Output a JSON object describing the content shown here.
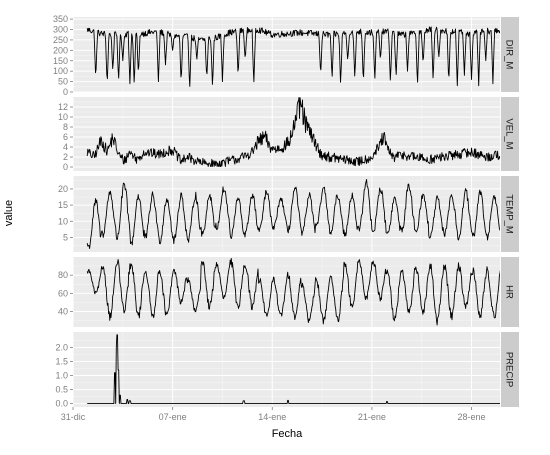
{
  "chart_data": {
    "type": "line",
    "xlabel": "Fecha",
    "ylabel": "value",
    "x_range": [
      "2012-12-31",
      "2013-01-30"
    ],
    "x_ticks": [
      {
        "label": "31-dic",
        "date": "2012-12-31"
      },
      {
        "label": "07-ene",
        "date": "2013-01-07"
      },
      {
        "label": "14-ene",
        "date": "2013-01-14"
      },
      {
        "label": "21-ene",
        "date": "2013-01-21"
      },
      {
        "label": "28-ene",
        "date": "2013-01-28"
      }
    ],
    "data_start": "2013-01-01",
    "data_end": "2013-01-30",
    "colors": {
      "line": "#000000",
      "panel_bg": "#ebebeb",
      "grid_major": "#ffffff",
      "strip_bg": "#cccccc",
      "tick_text": "#7f7f7f"
    },
    "grid": true,
    "panels": [
      {
        "name": "DIR_M",
        "ylim": [
          0,
          360
        ],
        "y_ticks": [
          0,
          50,
          100,
          150,
          200,
          250,
          300,
          350
        ],
        "y_tick_labels": [
          "0",
          "50",
          "100",
          "150",
          "200",
          "250",
          "300",
          "350"
        ],
        "pattern": "direction",
        "anchors": [
          [
            1,
            300
          ],
          [
            2,
            280
          ],
          [
            3,
            275
          ],
          [
            4,
            280
          ],
          [
            5,
            282
          ],
          [
            6,
            290
          ],
          [
            7,
            270
          ],
          [
            8,
            265
          ],
          [
            9,
            250
          ],
          [
            10,
            260
          ],
          [
            11,
            285
          ],
          [
            12,
            295
          ],
          [
            13,
            300
          ],
          [
            14,
            275
          ],
          [
            15,
            280
          ],
          [
            16,
            285
          ],
          [
            17,
            280
          ],
          [
            18,
            275
          ],
          [
            19,
            280
          ],
          [
            20,
            290
          ],
          [
            21,
            285
          ],
          [
            22,
            290
          ],
          [
            23,
            275
          ],
          [
            24,
            280
          ],
          [
            25,
            300
          ],
          [
            26,
            295
          ],
          [
            27,
            290
          ],
          [
            28,
            280
          ],
          [
            29,
            290
          ],
          [
            30,
            300
          ]
        ],
        "events": [
          [
            1.6,
            60
          ],
          [
            2.4,
            30
          ],
          [
            2.8,
            100
          ],
          [
            3.2,
            50
          ],
          [
            3.5,
            150
          ],
          [
            4.0,
            40
          ],
          [
            4.3,
            30
          ],
          [
            4.6,
            80
          ],
          [
            6.0,
            50
          ],
          [
            6.5,
            130
          ],
          [
            7.0,
            200
          ],
          [
            7.6,
            40
          ],
          [
            8.2,
            10
          ],
          [
            8.7,
            150
          ],
          [
            9.4,
            60
          ],
          [
            9.8,
            20
          ],
          [
            10.5,
            50
          ],
          [
            11.6,
            70
          ],
          [
            12.1,
            150
          ],
          [
            12.7,
            30
          ],
          [
            17.4,
            80
          ],
          [
            18.2,
            60
          ],
          [
            18.8,
            30
          ],
          [
            19.3,
            150
          ],
          [
            19.8,
            60
          ],
          [
            20.4,
            40
          ],
          [
            21.2,
            50
          ],
          [
            21.6,
            150
          ],
          [
            22.3,
            40
          ],
          [
            22.7,
            70
          ],
          [
            23.5,
            100
          ],
          [
            24.2,
            30
          ],
          [
            24.6,
            130
          ],
          [
            25.3,
            50
          ],
          [
            25.7,
            160
          ],
          [
            26.4,
            40
          ],
          [
            27.0,
            30
          ],
          [
            27.5,
            80
          ],
          [
            28.0,
            60
          ],
          [
            28.5,
            30
          ],
          [
            29.0,
            150
          ],
          [
            29.5,
            40
          ]
        ]
      },
      {
        "name": "VEL_M",
        "ylim": [
          -0.8,
          14
        ],
        "y_ticks": [
          0,
          2,
          4,
          6,
          8,
          10,
          12
        ],
        "y_tick_labels": [
          "0",
          "2",
          "4",
          "6",
          "8",
          "10",
          "12"
        ],
        "pattern": "noisy",
        "anchors": [
          [
            1,
            3
          ],
          [
            1.5,
            2
          ],
          [
            2,
            5.5
          ],
          [
            2.4,
            3
          ],
          [
            2.8,
            6
          ],
          [
            3.2,
            2.5
          ],
          [
            3.6,
            1.2
          ],
          [
            4,
            3
          ],
          [
            4.5,
            1.5
          ],
          [
            5,
            3
          ],
          [
            6,
            2.5
          ],
          [
            7,
            3.5
          ],
          [
            7.6,
            1
          ],
          [
            8,
            2
          ],
          [
            9,
            0.8
          ],
          [
            10,
            0.5
          ],
          [
            11,
            1.2
          ],
          [
            12,
            2
          ],
          [
            12.6,
            3
          ],
          [
            13,
            5
          ],
          [
            13.5,
            6
          ],
          [
            13.8,
            4
          ],
          [
            14.2,
            3.5
          ],
          [
            14.7,
            4
          ],
          [
            15.2,
            5
          ],
          [
            15.6,
            9
          ],
          [
            16,
            12.5
          ],
          [
            16.3,
            9
          ],
          [
            16.6,
            7
          ],
          [
            17,
            5
          ],
          [
            17.4,
            2.5
          ],
          [
            18,
            2
          ],
          [
            19,
            1.5
          ],
          [
            20,
            1
          ],
          [
            21,
            2
          ],
          [
            21.5,
            4
          ],
          [
            21.8,
            6
          ],
          [
            22.2,
            3
          ],
          [
            22.6,
            1.8
          ],
          [
            23,
            2.5
          ],
          [
            24,
            2
          ],
          [
            25,
            1.5
          ],
          [
            26,
            2
          ],
          [
            27,
            2.5
          ],
          [
            28,
            3
          ],
          [
            29,
            2
          ],
          [
            30,
            2.5
          ]
        ]
      },
      {
        "name": "TEMP_M",
        "ylim": [
          0.5,
          24
        ],
        "y_ticks": [
          5,
          10,
          15,
          20
        ],
        "y_tick_labels": [
          "5",
          "10",
          "15",
          "20"
        ],
        "pattern": "daily",
        "min_max": [
          [
            2,
            9,
            16
          ],
          [
            6,
            10,
            19
          ],
          [
            5,
            10,
            21
          ],
          [
            3,
            11,
            18
          ],
          [
            5,
            12,
            18
          ],
          [
            4,
            12,
            17
          ],
          [
            4,
            12,
            18
          ],
          [
            4,
            12,
            18
          ],
          [
            6,
            13,
            18
          ],
          [
            8,
            13,
            20
          ],
          [
            5,
            11,
            17
          ],
          [
            6,
            13,
            18
          ],
          [
            7,
            13,
            19
          ],
          [
            8,
            14,
            17
          ],
          [
            7,
            14,
            20
          ],
          [
            6,
            12,
            18
          ],
          [
            8,
            13,
            20
          ],
          [
            6,
            12,
            18
          ],
          [
            6,
            12,
            18
          ],
          [
            7,
            13,
            22
          ],
          [
            7,
            13,
            20
          ],
          [
            6,
            12,
            17
          ],
          [
            7,
            12,
            21
          ],
          [
            7,
            12,
            18
          ],
          [
            5,
            11,
            17
          ],
          [
            6,
            12,
            18
          ],
          [
            5,
            11,
            19
          ],
          [
            5,
            11,
            19
          ],
          [
            5,
            11,
            18
          ],
          [
            7,
            11,
            16
          ]
        ]
      },
      {
        "name": "HR",
        "ylim": [
          23,
          100
        ],
        "y_ticks": [
          40,
          60,
          80
        ],
        "y_tick_labels": [
          "40",
          "60",
          "80"
        ],
        "pattern": "daily_inverse",
        "min_max": [
          [
            60,
            82,
            85
          ],
          [
            35,
            65,
            90
          ],
          [
            40,
            70,
            95
          ],
          [
            35,
            65,
            90
          ],
          [
            35,
            68,
            85
          ],
          [
            35,
            65,
            85
          ],
          [
            50,
            70,
            85
          ],
          [
            40,
            60,
            75
          ],
          [
            45,
            75,
            95
          ],
          [
            55,
            82,
            92
          ],
          [
            45,
            75,
            95
          ],
          [
            45,
            72,
            92
          ],
          [
            35,
            60,
            75
          ],
          [
            35,
            55,
            75
          ],
          [
            35,
            55,
            80
          ],
          [
            30,
            50,
            70
          ],
          [
            30,
            52,
            75
          ],
          [
            30,
            55,
            80
          ],
          [
            45,
            72,
            92
          ],
          [
            55,
            78,
            95
          ],
          [
            55,
            80,
            95
          ],
          [
            30,
            55,
            85
          ],
          [
            40,
            65,
            85
          ],
          [
            40,
            68,
            88
          ],
          [
            30,
            62,
            90
          ],
          [
            35,
            62,
            90
          ],
          [
            45,
            70,
            90
          ],
          [
            35,
            65,
            85
          ],
          [
            35,
            60,
            85
          ],
          [
            45,
            72,
            90
          ]
        ]
      },
      {
        "name": "PRECIP",
        "ylim": [
          -0.12,
          2.55
        ],
        "y_ticks": [
          0,
          0.5,
          1,
          1.5,
          2
        ],
        "y_tick_labels": [
          "0.0",
          "0.5",
          "1.0",
          "1.5",
          "2.0"
        ],
        "pattern": "spikes",
        "spikes": [
          [
            2.95,
            1.1
          ],
          [
            3.05,
            2.0
          ],
          [
            3.12,
            2.45
          ],
          [
            3.2,
            1.2
          ],
          [
            3.3,
            0.3
          ],
          [
            3.8,
            0.15
          ],
          [
            4.0,
            0.1
          ],
          [
            12.0,
            0.1
          ],
          [
            15.1,
            0.12
          ],
          [
            22.05,
            0.08
          ]
        ]
      }
    ]
  }
}
